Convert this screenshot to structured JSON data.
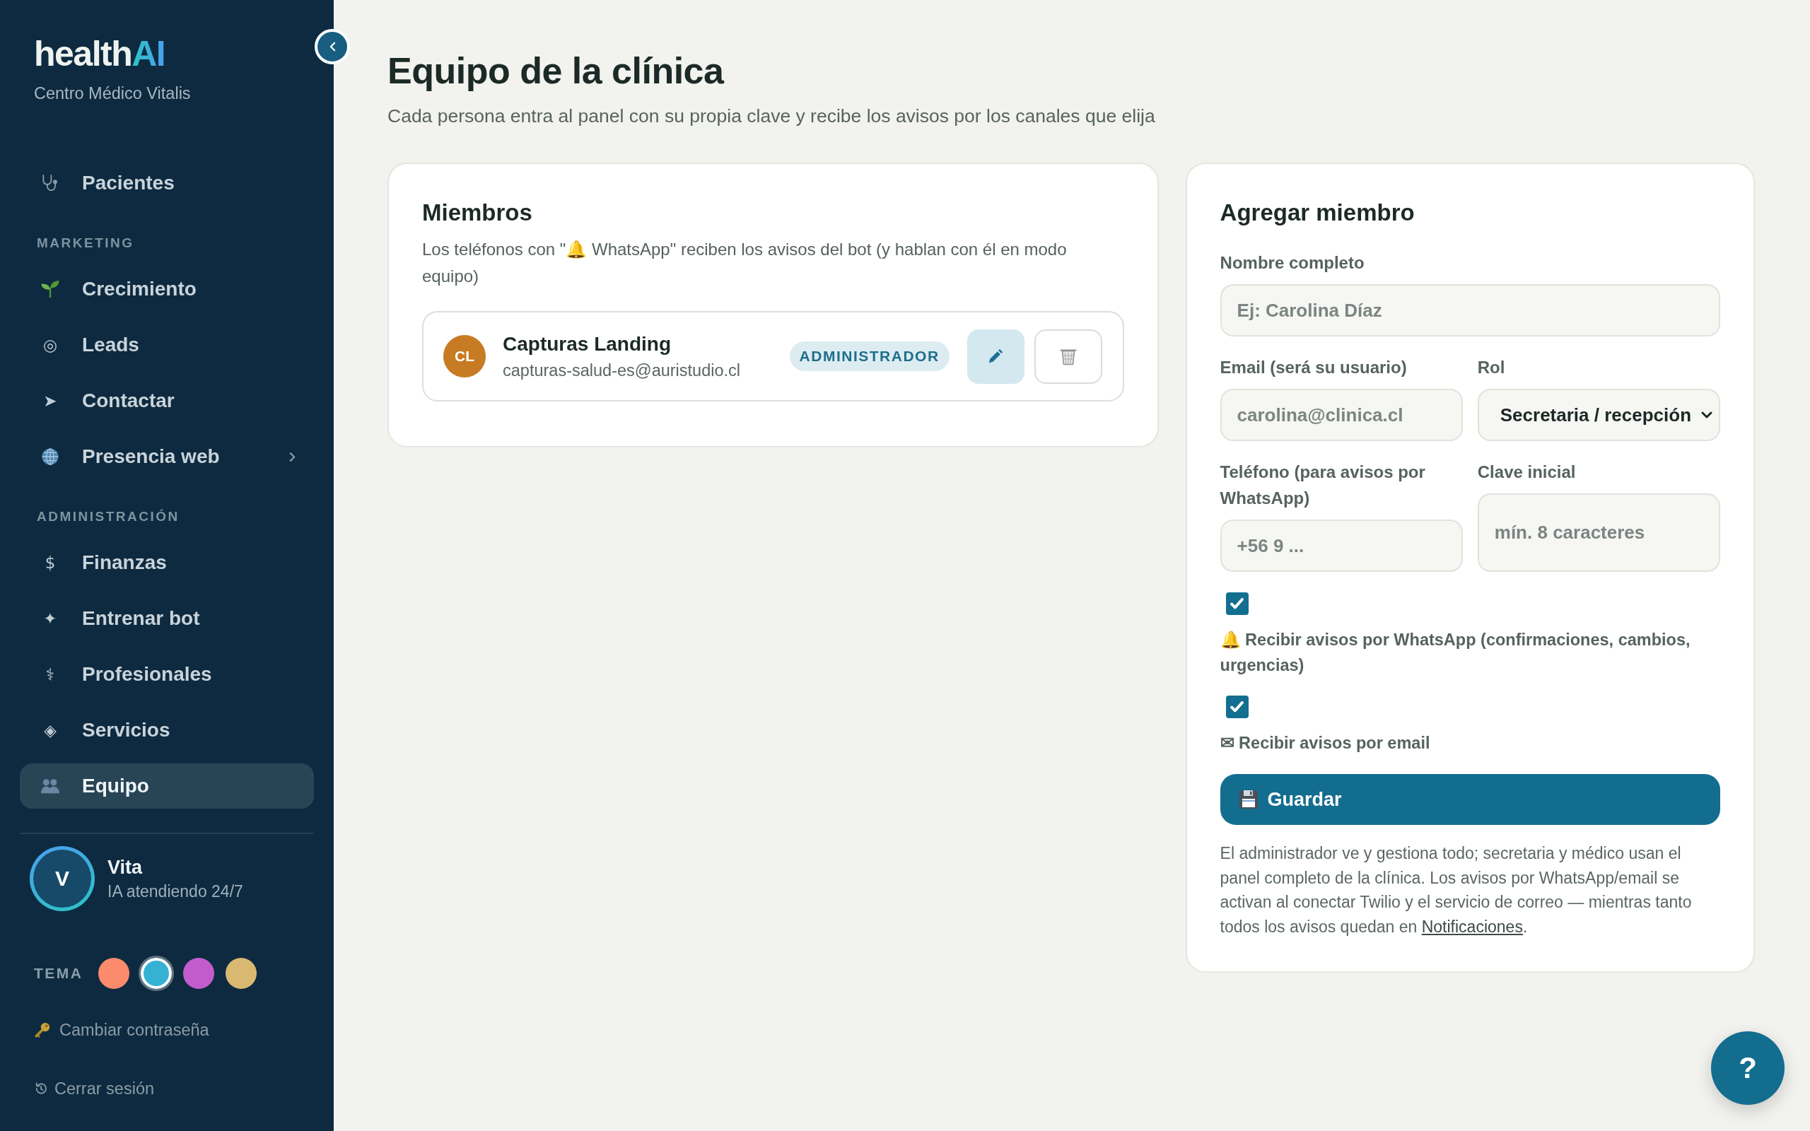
{
  "sidebar": {
    "logo": {
      "name": "health",
      "accent": "AI"
    },
    "clinic": "Centro Médico Vitalis",
    "sections": [
      {
        "items": [
          {
            "label": "Pacientes",
            "kind": "link",
            "selected": false
          }
        ]
      },
      {
        "heading": "MARKETING",
        "items": [
          {
            "label": "Crecimiento",
            "kind": "link",
            "selected": false
          },
          {
            "icon": "◎",
            "label": "Leads",
            "kind": "link",
            "selected": false
          },
          {
            "icon": "➤",
            "label": "Contactar",
            "kind": "link",
            "selected": false
          },
          {
            "label": "Presencia web",
            "kind": "group",
            "selected": false
          }
        ]
      },
      {
        "heading": "ADMINISTRACIÓN",
        "items": [
          {
            "icon": "$",
            "label": "Finanzas",
            "kind": "link",
            "selected": false
          },
          {
            "icon": "✦",
            "label": "Entrenar bot",
            "kind": "link",
            "selected": false
          },
          {
            "icon": "⚕",
            "label": "Profesionales",
            "kind": "link",
            "selected": false
          },
          {
            "icon": "◈",
            "label": "Servicios",
            "kind": "link",
            "selected": false
          },
          {
            "label": "Equipo",
            "kind": "link",
            "selected": true
          }
        ]
      }
    ],
    "assistant": {
      "initial": "V",
      "name": "Vita",
      "status": "IA atendiendo 24/7"
    },
    "theme": {
      "label": "TEMA",
      "swatches": [
        {
          "color": "#fc8a6c",
          "selected": false
        },
        {
          "color": "#35b2d3",
          "selected": true
        },
        {
          "color": "#c25ccd",
          "selected": false
        },
        {
          "color": "#d9b872",
          "selected": false
        }
      ]
    },
    "links": [
      "Cambiar contraseña",
      "Cerrar sesión"
    ]
  },
  "page": {
    "title": "Equipo de la clínica",
    "subtitle": "Cada persona entra al panel con su propia clave y recibe los avisos por los canales que elija"
  },
  "members": {
    "title": "Miembros",
    "description": "Los teléfonos con \"🔔 WhatsApp\" reciben los avisos del bot (y hablan con él en modo equipo)",
    "list": [
      {
        "initials": "CL",
        "name": "Capturas Landing",
        "email": "capturas-salud-es@auristudio.cl",
        "role": "ADMINISTRADOR"
      }
    ]
  },
  "add_member": {
    "title": "Agregar miembro",
    "rows": [
      [
        {
          "kind": "text",
          "label": "Nombre completo",
          "placeholder": "Ej: Carolina Díaz"
        }
      ],
      [
        {
          "kind": "text",
          "label": "Email (será su usuario)",
          "placeholder": "carolina@clinica.cl"
        },
        {
          "kind": "select",
          "label": "Rol",
          "value": "Secretaria / recepción"
        }
      ],
      [
        {
          "kind": "text",
          "label": "Teléfono (para avisos por WhatsApp)",
          "placeholder": "+56 9 ..."
        },
        {
          "kind": "password",
          "label": "Clave inicial",
          "placeholder": "mín. 8 caracteres"
        }
      ]
    ],
    "checkboxes": [
      {
        "label": "🔔 Recibir avisos por WhatsApp (confirmaciones, cambios, urgencias)",
        "checked": true
      },
      {
        "label": "✉ Recibir avisos por email",
        "checked": true
      }
    ],
    "submit": "Guardar",
    "note": {
      "text": "El administrador ve y gestiona todo; secretaria y médico usan el panel completo de la clínica. Los avisos por WhatsApp/email se activan al conectar Twilio y el servicio de correo — mientras tanto todos los avisos quedan en ",
      "link": "Notificaciones",
      "end": "."
    }
  },
  "help_button": "?"
}
